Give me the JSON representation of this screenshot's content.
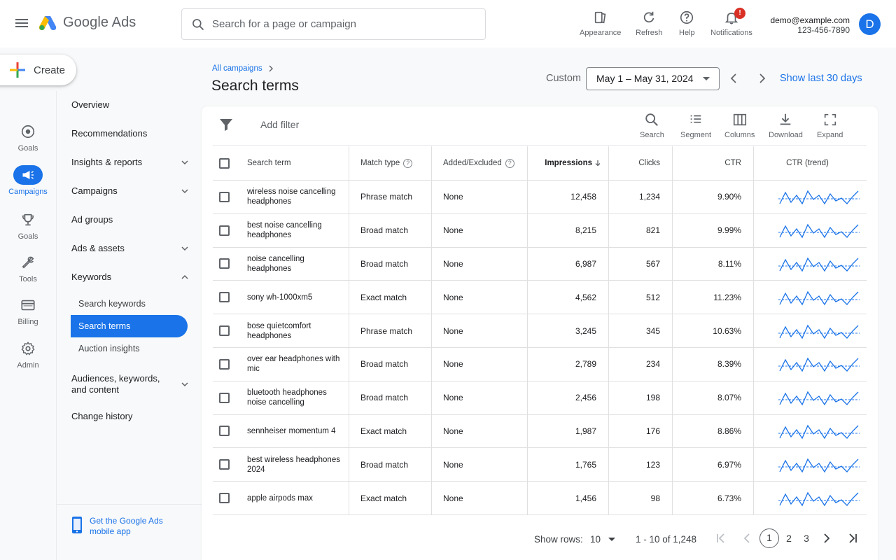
{
  "header": {
    "logo_text": "Google Ads",
    "search_placeholder": "Search for a page or campaign",
    "buttons": [
      {
        "label": "Appearance",
        "icon": "appearance-icon"
      },
      {
        "label": "Refresh",
        "icon": "refresh-icon"
      },
      {
        "label": "Help",
        "icon": "help-icon"
      },
      {
        "label": "Notifications",
        "icon": "bell-icon"
      }
    ],
    "notification_badge": "!",
    "account_email": "demo@example.com",
    "account_phone": "123-456-7890",
    "avatar_letter": "D"
  },
  "create": {
    "label": "Create"
  },
  "rail": [
    {
      "label": "Goals",
      "icon": "target-icon",
      "active": false
    },
    {
      "label": "Campaigns",
      "icon": "megaphone-icon",
      "active": true
    },
    {
      "label": "Goals",
      "icon": "trophy-icon",
      "active": false
    },
    {
      "label": "Tools",
      "icon": "wrench-icon",
      "active": false
    },
    {
      "label": "Billing",
      "icon": "card-icon",
      "active": false
    },
    {
      "label": "Admin",
      "icon": "gear-icon",
      "active": false
    }
  ],
  "nav": {
    "items": [
      {
        "label": "Overview",
        "chevron": ""
      },
      {
        "label": "Recommendations",
        "chevron": ""
      },
      {
        "label": "Insights & reports",
        "chevron": "down"
      },
      {
        "label": "Campaigns",
        "chevron": "down"
      },
      {
        "label": "Ad groups",
        "chevron": ""
      },
      {
        "label": "Ads & assets",
        "chevron": "down"
      },
      {
        "label": "Keywords",
        "chevron": "up"
      }
    ],
    "sub_items": [
      "Search keywords",
      "Search terms",
      "Auction insights"
    ],
    "active_sub": "Search terms",
    "audiences_line1": "Audiences, keywords,",
    "audiences_line2": "and content",
    "change_history": "Change history",
    "mobile_app": "Get the Google Ads mobile app"
  },
  "page": {
    "breadcrumb": "All campaigns",
    "title": "Search terms",
    "date_label": "Custom",
    "date_range": "May 1 – May 31, 2024",
    "show_last": "Show last 30 days"
  },
  "toolbar": {
    "add_filter": "Add filter",
    "tools": [
      {
        "label": "Search",
        "icon": "search-icon"
      },
      {
        "label": "Segment",
        "icon": "segment-icon"
      },
      {
        "label": "Columns",
        "icon": "columns-icon"
      },
      {
        "label": "Download",
        "icon": "download-icon"
      },
      {
        "label": "Expand",
        "icon": "expand-icon"
      }
    ]
  },
  "table": {
    "columns": [
      "Search term",
      "Match type",
      "Added/Excluded",
      "Impressions",
      "Clicks",
      "CTR",
      "CTR (trend)"
    ],
    "sort_column": "Impressions",
    "rows": [
      {
        "term": "wireless noise cancelling headphones",
        "match": "Phrase match",
        "added": "None",
        "impressions": "12,458",
        "clicks": "1,234",
        "ctr": "9.90%"
      },
      {
        "term": "best noise cancelling headphones",
        "match": "Broad match",
        "added": "None",
        "impressions": "8,215",
        "clicks": "821",
        "ctr": "9.99%"
      },
      {
        "term": "noise cancelling headphones",
        "match": "Broad match",
        "added": "None",
        "impressions": "6,987",
        "clicks": "567",
        "ctr": "8.11%"
      },
      {
        "term": "sony wh-1000xm5",
        "match": "Exact match",
        "added": "None",
        "impressions": "4,562",
        "clicks": "512",
        "ctr": "11.23%"
      },
      {
        "term": "bose quietcomfort headphones",
        "match": "Phrase match",
        "added": "None",
        "impressions": "3,245",
        "clicks": "345",
        "ctr": "10.63%"
      },
      {
        "term": "over ear headphones with mic",
        "match": "Broad match",
        "added": "None",
        "impressions": "2,789",
        "clicks": "234",
        "ctr": "8.39%"
      },
      {
        "term": "bluetooth headphones noise cancelling",
        "match": "Broad match",
        "added": "None",
        "impressions": "2,456",
        "clicks": "198",
        "ctr": "8.07%"
      },
      {
        "term": "sennheiser momentum 4",
        "match": "Exact match",
        "added": "None",
        "impressions": "1,987",
        "clicks": "176",
        "ctr": "8.86%"
      },
      {
        "term": "best wireless headphones 2024",
        "match": "Broad match",
        "added": "None",
        "impressions": "1,765",
        "clicks": "123",
        "ctr": "6.97%"
      },
      {
        "term": "apple airpods max",
        "match": "Exact match",
        "added": "None",
        "impressions": "1,456",
        "clicks": "98",
        "ctr": "6.73%"
      }
    ]
  },
  "pagination": {
    "show_rows_label": "Show rows:",
    "rows_value": "10",
    "range": "1 - 10 of 1,248",
    "pages": [
      "1",
      "2",
      "3"
    ],
    "current_page": "1"
  },
  "colors": {
    "accent": "#1a73e8",
    "badge": "#d93025",
    "logo_blue": "#4285f4",
    "logo_green": "#34a853",
    "logo_yellow": "#fbbc04"
  }
}
